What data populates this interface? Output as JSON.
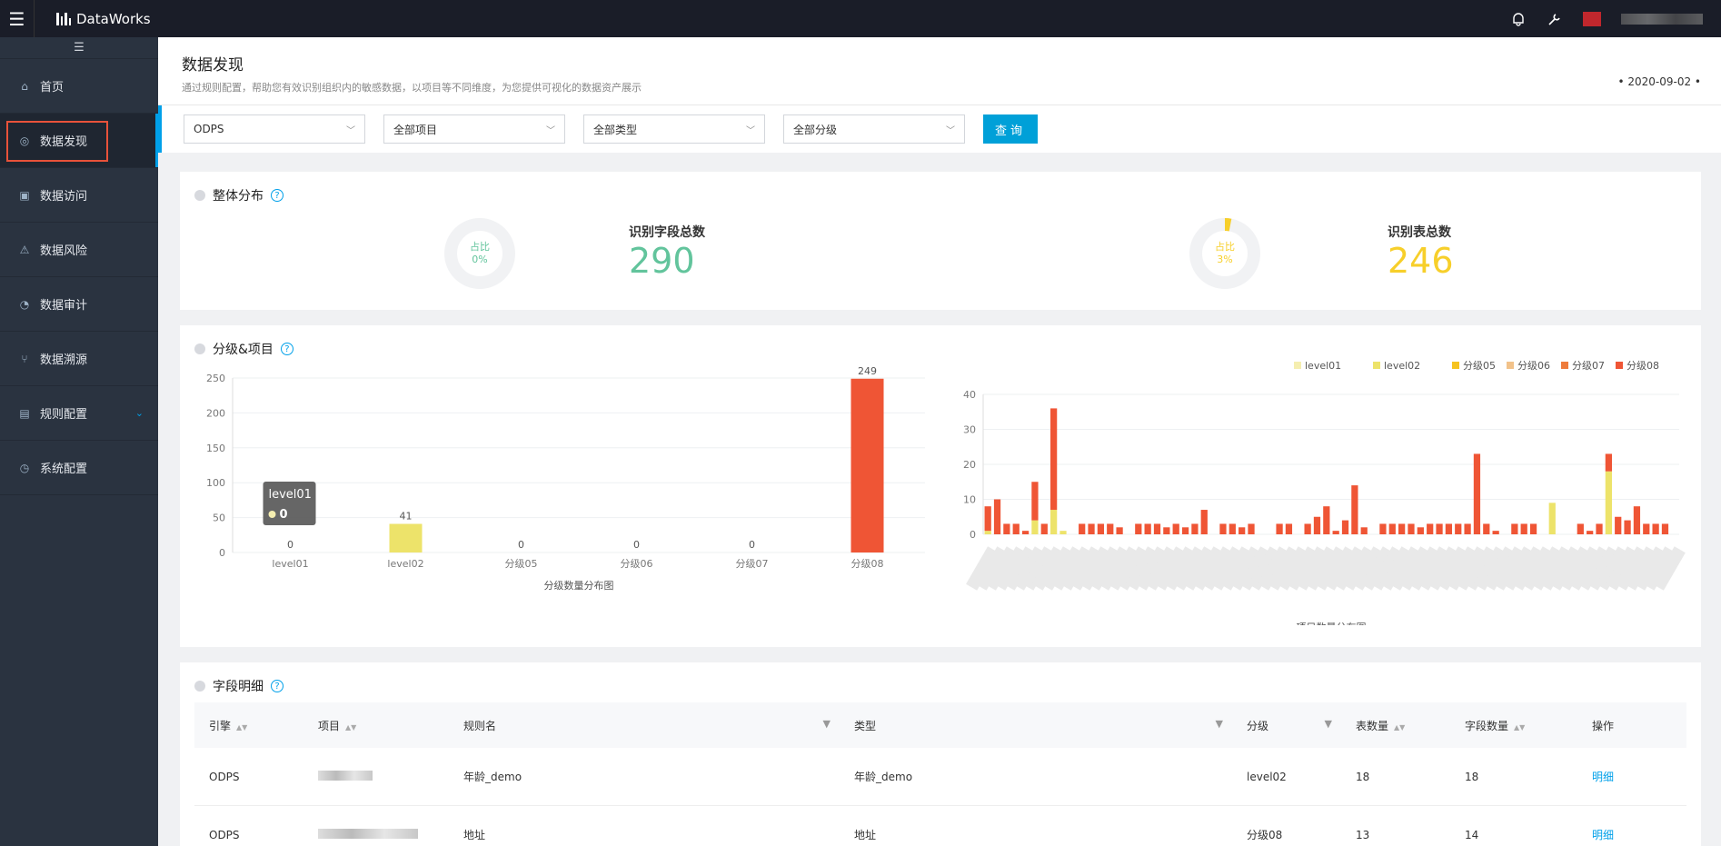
{
  "app": {
    "brand": "DataWorks"
  },
  "sidebar": {
    "items": [
      {
        "label": "首页",
        "icon": "home-icon"
      },
      {
        "label": "数据发现",
        "icon": "discover-icon",
        "active": true
      },
      {
        "label": "数据访问",
        "icon": "access-icon"
      },
      {
        "label": "数据风险",
        "icon": "risk-icon"
      },
      {
        "label": "数据审计",
        "icon": "audit-icon"
      },
      {
        "label": "数据溯源",
        "icon": "trace-icon"
      },
      {
        "label": "规则配置",
        "icon": "rule-icon",
        "expandable": true
      },
      {
        "label": "系统配置",
        "icon": "system-icon"
      }
    ]
  },
  "page": {
    "title": "数据发现",
    "subtitle": "通过规则配置，帮助您有效识别组织内的敏感数据，以项目等不同维度，为您提供可视化的数据资产展示",
    "date": "• 2020-09-02 •"
  },
  "filters": {
    "engine": "ODPS",
    "project": "全部项目",
    "type": "全部类型",
    "level": "全部分级",
    "query_label": "查询"
  },
  "overview": {
    "title": "整体分布",
    "field_total": {
      "ratio_label": "占比",
      "ratio": "0%",
      "label": "识别字段总数",
      "value": "290",
      "ratio_value": 0
    },
    "table_total": {
      "ratio_label": "占比",
      "ratio": "3%",
      "label": "识别表总数",
      "value": "246",
      "ratio_value": 0.03
    }
  },
  "level_project": {
    "title": "分级&项目",
    "tooltip": {
      "name": "level01",
      "value": "0"
    }
  },
  "colors": {
    "level01": "#f5eeb0",
    "level02": "#ede36a",
    "分级05": "#f6c31f",
    "分级06": "#f2c28a",
    "分级07": "#ee7b3b",
    "分级08": "#ef5535",
    "accent": "#00a0e9",
    "field_value": "#62c49c",
    "table_value": "#f7cf2a"
  },
  "chart_data": [
    {
      "type": "bar",
      "xlabel": "分级数量分布图",
      "categories": [
        "level01",
        "level02",
        "分级05",
        "分级06",
        "分级07",
        "分级08"
      ],
      "values": [
        0,
        41,
        0,
        0,
        0,
        249
      ],
      "ylim": [
        0,
        250
      ],
      "yticks": [
        0,
        50,
        100,
        150,
        200,
        250
      ],
      "grid": true
    },
    {
      "type": "bar",
      "stacked": true,
      "xlabel": "项目数量分布图",
      "ylim": [
        0,
        40
      ],
      "yticks": [
        0,
        10,
        20,
        30,
        40
      ],
      "legend_position": "top-right",
      "legend": [
        "level01",
        "level02",
        "分级05",
        "分级06",
        "分级07",
        "分级08"
      ],
      "series": [
        {
          "name": "level02",
          "values": [
            1,
            0,
            0,
            0,
            0,
            4,
            0,
            7,
            1,
            0,
            0,
            0,
            0,
            0,
            0,
            0,
            0,
            0,
            0,
            0,
            0,
            0,
            0,
            0,
            0,
            0,
            0,
            0,
            0,
            0,
            0,
            0,
            0,
            0,
            0,
            0,
            0,
            0,
            0,
            0,
            0,
            0,
            0,
            0,
            0,
            0,
            0,
            0,
            0,
            0,
            0,
            0,
            0,
            0,
            0,
            0,
            0,
            0,
            0,
            0,
            9,
            0,
            0,
            0,
            0,
            0,
            18,
            0,
            0,
            0,
            0,
            0,
            0,
            0
          ]
        },
        {
          "name": "分级08",
          "values": [
            7,
            10,
            3,
            3,
            1,
            11,
            3,
            29,
            0,
            0,
            3,
            3,
            3,
            3,
            2,
            0,
            3,
            3,
            3,
            2,
            3,
            2,
            3,
            7,
            0,
            3,
            3,
            2,
            3,
            0,
            0,
            3,
            3,
            0,
            3,
            5,
            8,
            1,
            4,
            14,
            2,
            0,
            3,
            3,
            3,
            3,
            2,
            3,
            3,
            3,
            3,
            3,
            23,
            3,
            1,
            0,
            3,
            3,
            3,
            0,
            0,
            0,
            0,
            3,
            1,
            3,
            5,
            5,
            4,
            8,
            3,
            3,
            3,
            0
          ]
        }
      ]
    }
  ],
  "detail": {
    "title": "字段明细",
    "columns": [
      "引擎",
      "项目",
      "规则名",
      "类型",
      "分级",
      "表数量",
      "字段数量",
      "操作"
    ],
    "rows": [
      {
        "engine": "ODPS",
        "rule": "年龄_demo",
        "type": "年龄_demo",
        "level": "level02",
        "tables": "18",
        "fields": "18",
        "action": "明细"
      },
      {
        "engine": "ODPS",
        "rule": "地址",
        "type": "地址",
        "level": "分级08",
        "tables": "13",
        "fields": "14",
        "action": "明细"
      }
    ]
  }
}
